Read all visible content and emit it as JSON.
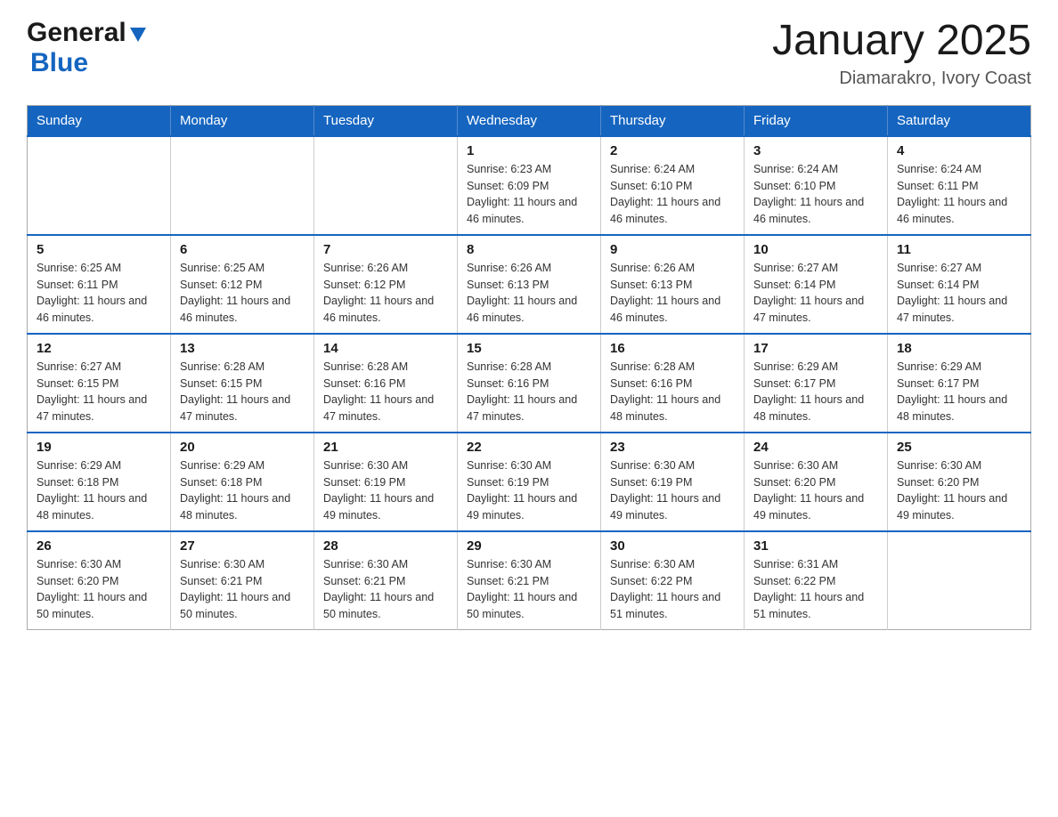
{
  "logo": {
    "general_text": "General",
    "blue_text": "Blue"
  },
  "header": {
    "month_year": "January 2025",
    "location": "Diamarakro, Ivory Coast"
  },
  "days_of_week": [
    "Sunday",
    "Monday",
    "Tuesday",
    "Wednesday",
    "Thursday",
    "Friday",
    "Saturday"
  ],
  "weeks": [
    [
      {
        "day": "",
        "info": ""
      },
      {
        "day": "",
        "info": ""
      },
      {
        "day": "",
        "info": ""
      },
      {
        "day": "1",
        "info": "Sunrise: 6:23 AM\nSunset: 6:09 PM\nDaylight: 11 hours and 46 minutes."
      },
      {
        "day": "2",
        "info": "Sunrise: 6:24 AM\nSunset: 6:10 PM\nDaylight: 11 hours and 46 minutes."
      },
      {
        "day": "3",
        "info": "Sunrise: 6:24 AM\nSunset: 6:10 PM\nDaylight: 11 hours and 46 minutes."
      },
      {
        "day": "4",
        "info": "Sunrise: 6:24 AM\nSunset: 6:11 PM\nDaylight: 11 hours and 46 minutes."
      }
    ],
    [
      {
        "day": "5",
        "info": "Sunrise: 6:25 AM\nSunset: 6:11 PM\nDaylight: 11 hours and 46 minutes."
      },
      {
        "day": "6",
        "info": "Sunrise: 6:25 AM\nSunset: 6:12 PM\nDaylight: 11 hours and 46 minutes."
      },
      {
        "day": "7",
        "info": "Sunrise: 6:26 AM\nSunset: 6:12 PM\nDaylight: 11 hours and 46 minutes."
      },
      {
        "day": "8",
        "info": "Sunrise: 6:26 AM\nSunset: 6:13 PM\nDaylight: 11 hours and 46 minutes."
      },
      {
        "day": "9",
        "info": "Sunrise: 6:26 AM\nSunset: 6:13 PM\nDaylight: 11 hours and 46 minutes."
      },
      {
        "day": "10",
        "info": "Sunrise: 6:27 AM\nSunset: 6:14 PM\nDaylight: 11 hours and 47 minutes."
      },
      {
        "day": "11",
        "info": "Sunrise: 6:27 AM\nSunset: 6:14 PM\nDaylight: 11 hours and 47 minutes."
      }
    ],
    [
      {
        "day": "12",
        "info": "Sunrise: 6:27 AM\nSunset: 6:15 PM\nDaylight: 11 hours and 47 minutes."
      },
      {
        "day": "13",
        "info": "Sunrise: 6:28 AM\nSunset: 6:15 PM\nDaylight: 11 hours and 47 minutes."
      },
      {
        "day": "14",
        "info": "Sunrise: 6:28 AM\nSunset: 6:16 PM\nDaylight: 11 hours and 47 minutes."
      },
      {
        "day": "15",
        "info": "Sunrise: 6:28 AM\nSunset: 6:16 PM\nDaylight: 11 hours and 47 minutes."
      },
      {
        "day": "16",
        "info": "Sunrise: 6:28 AM\nSunset: 6:16 PM\nDaylight: 11 hours and 48 minutes."
      },
      {
        "day": "17",
        "info": "Sunrise: 6:29 AM\nSunset: 6:17 PM\nDaylight: 11 hours and 48 minutes."
      },
      {
        "day": "18",
        "info": "Sunrise: 6:29 AM\nSunset: 6:17 PM\nDaylight: 11 hours and 48 minutes."
      }
    ],
    [
      {
        "day": "19",
        "info": "Sunrise: 6:29 AM\nSunset: 6:18 PM\nDaylight: 11 hours and 48 minutes."
      },
      {
        "day": "20",
        "info": "Sunrise: 6:29 AM\nSunset: 6:18 PM\nDaylight: 11 hours and 48 minutes."
      },
      {
        "day": "21",
        "info": "Sunrise: 6:30 AM\nSunset: 6:19 PM\nDaylight: 11 hours and 49 minutes."
      },
      {
        "day": "22",
        "info": "Sunrise: 6:30 AM\nSunset: 6:19 PM\nDaylight: 11 hours and 49 minutes."
      },
      {
        "day": "23",
        "info": "Sunrise: 6:30 AM\nSunset: 6:19 PM\nDaylight: 11 hours and 49 minutes."
      },
      {
        "day": "24",
        "info": "Sunrise: 6:30 AM\nSunset: 6:20 PM\nDaylight: 11 hours and 49 minutes."
      },
      {
        "day": "25",
        "info": "Sunrise: 6:30 AM\nSunset: 6:20 PM\nDaylight: 11 hours and 49 minutes."
      }
    ],
    [
      {
        "day": "26",
        "info": "Sunrise: 6:30 AM\nSunset: 6:20 PM\nDaylight: 11 hours and 50 minutes."
      },
      {
        "day": "27",
        "info": "Sunrise: 6:30 AM\nSunset: 6:21 PM\nDaylight: 11 hours and 50 minutes."
      },
      {
        "day": "28",
        "info": "Sunrise: 6:30 AM\nSunset: 6:21 PM\nDaylight: 11 hours and 50 minutes."
      },
      {
        "day": "29",
        "info": "Sunrise: 6:30 AM\nSunset: 6:21 PM\nDaylight: 11 hours and 50 minutes."
      },
      {
        "day": "30",
        "info": "Sunrise: 6:30 AM\nSunset: 6:22 PM\nDaylight: 11 hours and 51 minutes."
      },
      {
        "day": "31",
        "info": "Sunrise: 6:31 AM\nSunset: 6:22 PM\nDaylight: 11 hours and 51 minutes."
      },
      {
        "day": "",
        "info": ""
      }
    ]
  ]
}
